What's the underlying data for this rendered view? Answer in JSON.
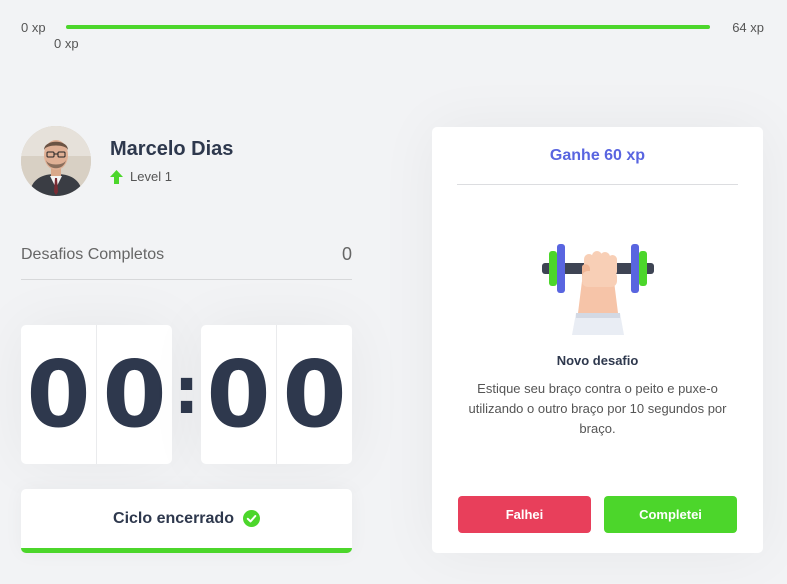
{
  "xp": {
    "min_label": "0 xp",
    "max_label": "64 xp",
    "current_label": "0 xp",
    "progress_fraction": 1.0
  },
  "profile": {
    "name": "Marcelo Dias",
    "level_label": "Level 1",
    "avatar_icon": "user-photo"
  },
  "completed_challenges": {
    "label": "Desafios Completos",
    "value": "0"
  },
  "countdown": {
    "minute_left": "0",
    "minute_right": "0",
    "separator": ":",
    "second_left": "0",
    "second_right": "0"
  },
  "cycle_button": {
    "label": "Ciclo encerrado",
    "icon": "check-circle-icon"
  },
  "challenge": {
    "header": "Ganhe 60 xp",
    "icon": "dumbbell-icon",
    "title": "Novo desafio",
    "description": "Estique seu braço contra o peito e puxe-o utilizando o outro braço por 10 segundos por braço.",
    "fail_label": "Falhei",
    "success_label": "Completei"
  },
  "colors": {
    "background": "#f2f3f5",
    "text": "#2e384d",
    "accent_blue": "#5965e0",
    "green": "#4cd62b",
    "red": "#e83f5b"
  }
}
